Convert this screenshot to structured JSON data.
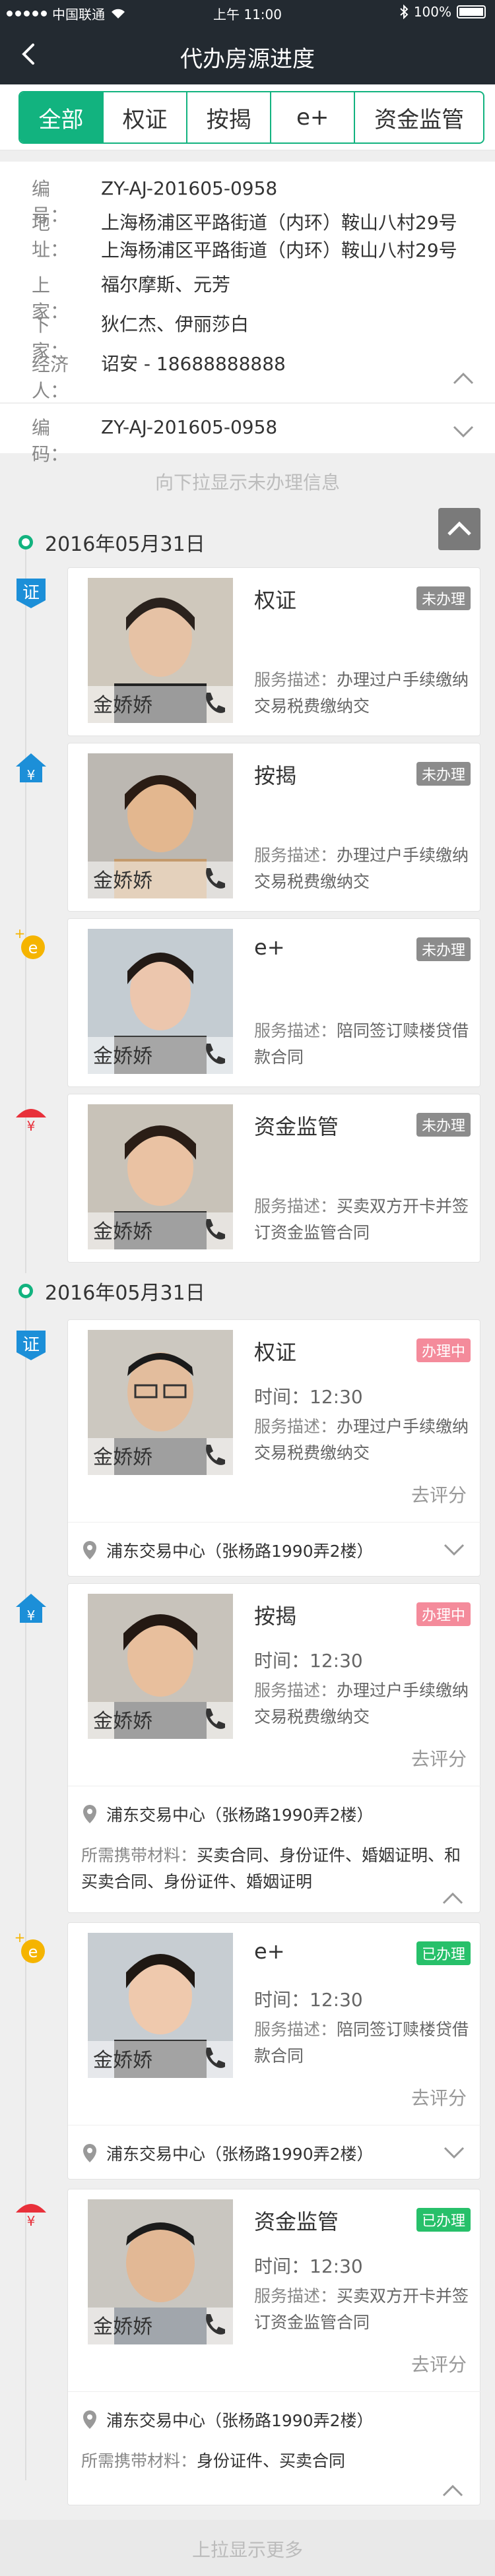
{
  "status_bar": {
    "carrier": "中国联通",
    "time": "上午 11:00",
    "battery": "100%"
  },
  "nav": {
    "title": "代办房源进度",
    "back_icon": "chevron-left-icon"
  },
  "tabs": [
    {
      "label": "全部",
      "active": true
    },
    {
      "label": "权证",
      "active": false
    },
    {
      "label": "按揭",
      "active": false
    },
    {
      "label": "e+",
      "active": false
    },
    {
      "label": "资金监管",
      "active": false
    }
  ],
  "info": {
    "number_key": "编　号：",
    "number": "ZY-AJ-201605-0958",
    "address_key": "地　址：",
    "address_line1": "上海杨浦区平路街道（内环）鞍山八村29号",
    "address_line2": "上海杨浦区平路街道（内环）鞍山八村29号",
    "seller_key": "上　家：",
    "seller": "福尔摩斯、元芳",
    "buyer_key": "下　家：",
    "buyer": "狄仁杰、伊丽莎白",
    "agent_key": "经济人：",
    "agent": "诏安 - 18688888888",
    "code_key": "编　码：",
    "code": "ZY-AJ-201605-0958"
  },
  "hints": {
    "pull_down": "向下拉显示未办理信息",
    "pull_up": "上拉显示更多"
  },
  "groups": [
    {
      "date": "2016年05月31日",
      "items": [
        {
          "icon": "certificate-icon",
          "title": "权证",
          "status": "未办理",
          "status_type": "todo",
          "agent": "金娇娇",
          "desc_label": "服务描述：",
          "desc": "办理过户手续缴纳交易税费缴纳交"
        },
        {
          "icon": "house-yen-icon",
          "title": "按揭",
          "status": "未办理",
          "status_type": "todo",
          "agent": "金娇娇",
          "desc_label": "服务描述：",
          "desc": "办理过户手续缴纳交易税费缴纳交"
        },
        {
          "icon": "e-plus-icon",
          "title": "e+",
          "status": "未办理",
          "status_type": "todo",
          "agent": "金娇娇",
          "desc_label": "服务描述：",
          "desc": "陪同签订赎楼贷借款合同"
        },
        {
          "icon": "umbrella-yen-icon",
          "title": "资金监管",
          "status": "未办理",
          "status_type": "todo",
          "agent": "金娇娇",
          "desc_label": "服务描述：",
          "desc": "买卖双方开卡并签订资金监管合同"
        }
      ]
    },
    {
      "date": "2016年05月31日",
      "items": [
        {
          "icon": "certificate-icon",
          "title": "权证",
          "status": "办理中",
          "status_type": "doing",
          "agent": "金娇娇",
          "time": "时间：12:30",
          "desc_label": "服务描述：",
          "desc": "办理过户手续缴纳交易税费缴纳交",
          "rate": "去评分",
          "location": "浦东交易中心（张杨路1990弄2楼）"
        },
        {
          "icon": "house-yen-icon",
          "title": "按揭",
          "status": "办理中",
          "status_type": "doing",
          "agent": "金娇娇",
          "time": "时间：12:30",
          "desc_label": "服务描述：",
          "desc": "办理过户手续缴纳交易税费缴纳交",
          "rate": "去评分",
          "location": "浦东交易中心（张杨路1990弄2楼）",
          "materials_label": "所需携带材料：",
          "materials": "买卖合同、身份证件、婚姻证明、和买卖合同、身份证件、婚姻证明"
        },
        {
          "icon": "e-plus-icon",
          "title": "e+",
          "status": "已办理",
          "status_type": "done",
          "agent": "金娇娇",
          "time": "时间：12:30",
          "desc_label": "服务描述：",
          "desc": "陪同签订赎楼贷借款合同",
          "rate": "去评分",
          "location": "浦东交易中心（张杨路1990弄2楼）"
        },
        {
          "icon": "umbrella-yen-icon",
          "title": "资金监管",
          "status": "已办理",
          "status_type": "done",
          "agent": "金娇娇",
          "time": "时间：12:30",
          "desc_label": "服务描述：",
          "desc": "买卖双方开卡并签订资金监管合同",
          "rate": "去评分",
          "location": "浦东交易中心（张杨路1990弄2楼）",
          "materials_label": "所需携带材料：",
          "materials": "身份证件、买卖合同"
        }
      ]
    }
  ],
  "colors": {
    "accent": "#12b37f",
    "nav": "#232a31",
    "todo": "#8c8c8c",
    "doing": "#f48b9b",
    "done": "#27c06a"
  }
}
